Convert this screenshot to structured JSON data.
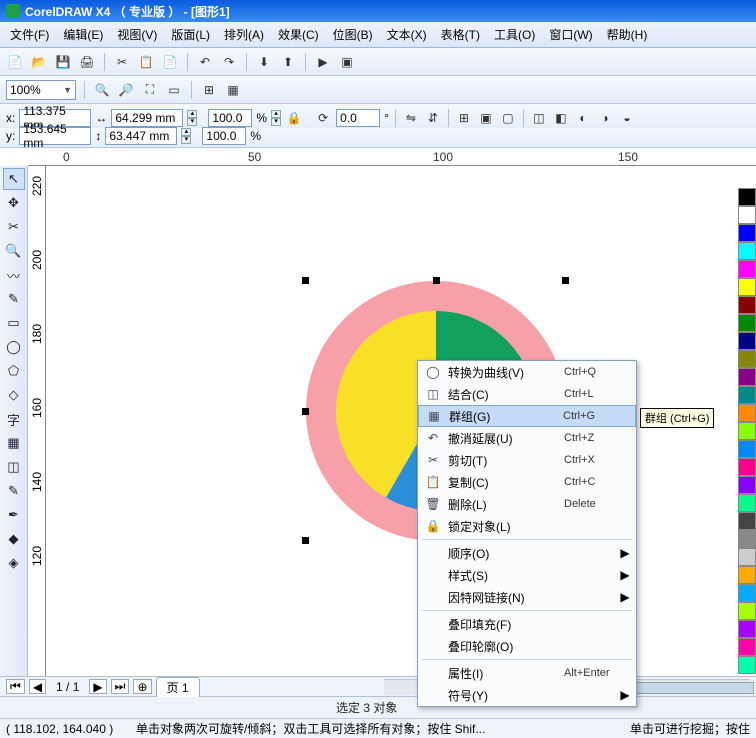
{
  "title": "CorelDRAW X4 （ 专业版 ） - [图形1]",
  "menu": [
    "文件(F)",
    "编辑(E)",
    "视图(V)",
    "版面(L)",
    "排列(A)",
    "效果(C)",
    "位图(B)",
    "文本(X)",
    "表格(T)",
    "工具(O)",
    "窗口(W)",
    "帮助(H)"
  ],
  "zoom": "100%",
  "props": {
    "x": "113.375 mm",
    "y": "153.645 mm",
    "w": "64.299 mm",
    "h": "63.447 mm",
    "sx": "100.0",
    "sy": "100.0",
    "rot": "0.0"
  },
  "rulerH": [
    "0",
    "50",
    "100",
    "150"
  ],
  "rulerV": [
    "220",
    "200",
    "180",
    "160",
    "140",
    "120"
  ],
  "context": [
    {
      "icon": "◯",
      "label": "转换为曲线(V)",
      "shortcut": "Ctrl+Q"
    },
    {
      "icon": "◫",
      "label": "结合(C)",
      "shortcut": "Ctrl+L"
    },
    {
      "icon": "▦",
      "label": "群组(G)",
      "shortcut": "Ctrl+G",
      "hl": true
    },
    {
      "icon": "↶",
      "label": "撤消延展(U)",
      "shortcut": "Ctrl+Z"
    },
    {
      "icon": "✂",
      "label": "剪切(T)",
      "shortcut": "Ctrl+X"
    },
    {
      "icon": "📋",
      "label": "复制(C)",
      "shortcut": "Ctrl+C"
    },
    {
      "icon": "🗑",
      "label": "删除(L)",
      "shortcut": "Delete"
    },
    {
      "icon": "🔒",
      "label": "锁定对象(L)",
      "shortcut": ""
    },
    {
      "sep": true
    },
    {
      "label": "顺序(O)",
      "sub": true
    },
    {
      "label": "样式(S)",
      "sub": true
    },
    {
      "label": "因特网链接(N)",
      "sub": true
    },
    {
      "sep": true
    },
    {
      "label": "叠印填充(F)"
    },
    {
      "label": "叠印轮廓(O)"
    },
    {
      "sep": true
    },
    {
      "label": "属性(I)",
      "shortcut": "Alt+Enter"
    },
    {
      "label": "符号(Y)",
      "sub": true
    }
  ],
  "tooltip": "群组 (Ctrl+G)",
  "pager": {
    "pos": "1 / 1",
    "tab": "页 1"
  },
  "status_sel": "选定 3 对象",
  "status_coord": "( 118.102, 164.040 )",
  "status_hint": "单击对象两次可旋转/倾斜；双击工具可选择所有对象；按住 Shif...",
  "status_hint2": "单击可进行挖掘；按住",
  "colors": [
    "#000",
    "#fff",
    "#00f",
    "#0ff",
    "#f0f",
    "#ff0",
    "#800",
    "#080",
    "#008",
    "#880",
    "#808",
    "#088",
    "#f80",
    "#8f0",
    "#08f",
    "#f08",
    "#80f",
    "#0f8",
    "#444",
    "#888",
    "#ccc",
    "#fa0",
    "#0af",
    "#af0",
    "#a0f",
    "#f0a",
    "#0fa"
  ]
}
